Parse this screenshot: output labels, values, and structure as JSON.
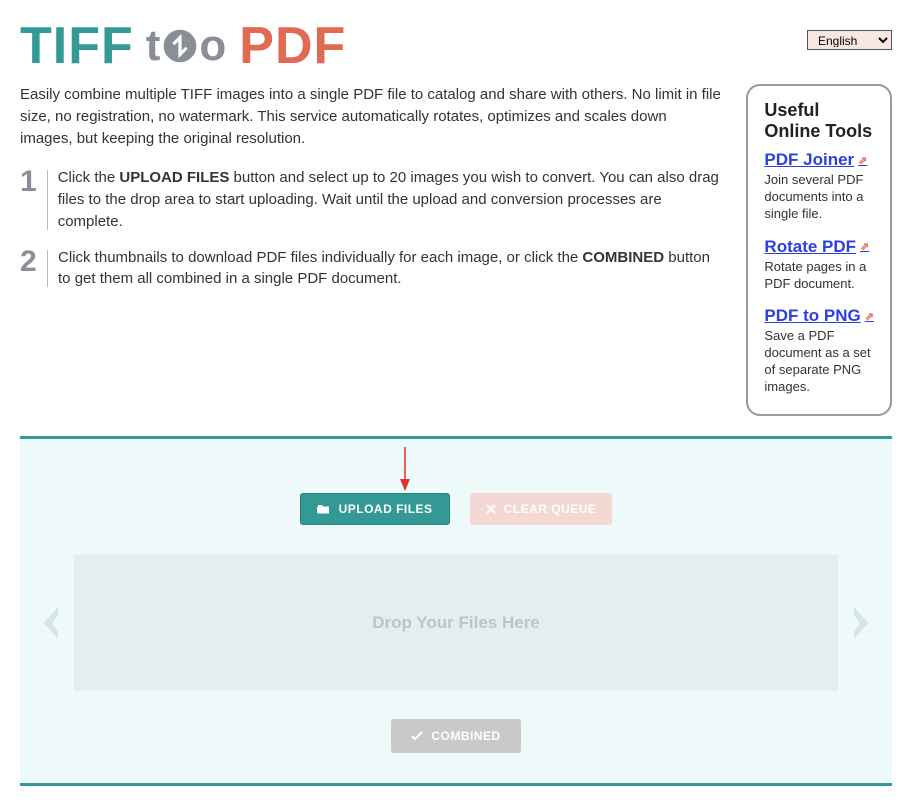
{
  "logo": {
    "tiff": "TIFF",
    "to_text": "t",
    "to_text2": "o",
    "pdf": "PDF"
  },
  "language": {
    "selected": "English"
  },
  "intro": "Easily combine multiple TIFF images into a single PDF file to catalog and share with others. No limit in file size, no registration, no watermark. This service automatically rotates, optimizes and scales down images, but keeping the original resolution.",
  "steps": [
    {
      "num": "1",
      "pre": "Click the ",
      "bold1": "UPLOAD FILES",
      "mid": " button and select up to 20 images you wish to convert. You can also drag files to the drop area to start uploading. Wait until the upload and conversion processes are complete."
    },
    {
      "num": "2",
      "pre": "Click thumbnails to download PDF files individually for each image, or click the ",
      "bold1": "COMBINED",
      "mid": " button to get them all combined in a single PDF document."
    }
  ],
  "sidebar": {
    "title": "Useful Online Tools",
    "tools": [
      {
        "name": "PDF Joiner",
        "desc": "Join several PDF documents into a single file."
      },
      {
        "name": "Rotate PDF",
        "desc": "Rotate pages in a PDF document."
      },
      {
        "name": "PDF to PNG",
        "desc": "Save a PDF document as a set of separate PNG images."
      }
    ]
  },
  "buttons": {
    "upload": "UPLOAD FILES",
    "clear": "CLEAR QUEUE",
    "combined": "COMBINED"
  },
  "dropzone": "Drop Your Files Here"
}
